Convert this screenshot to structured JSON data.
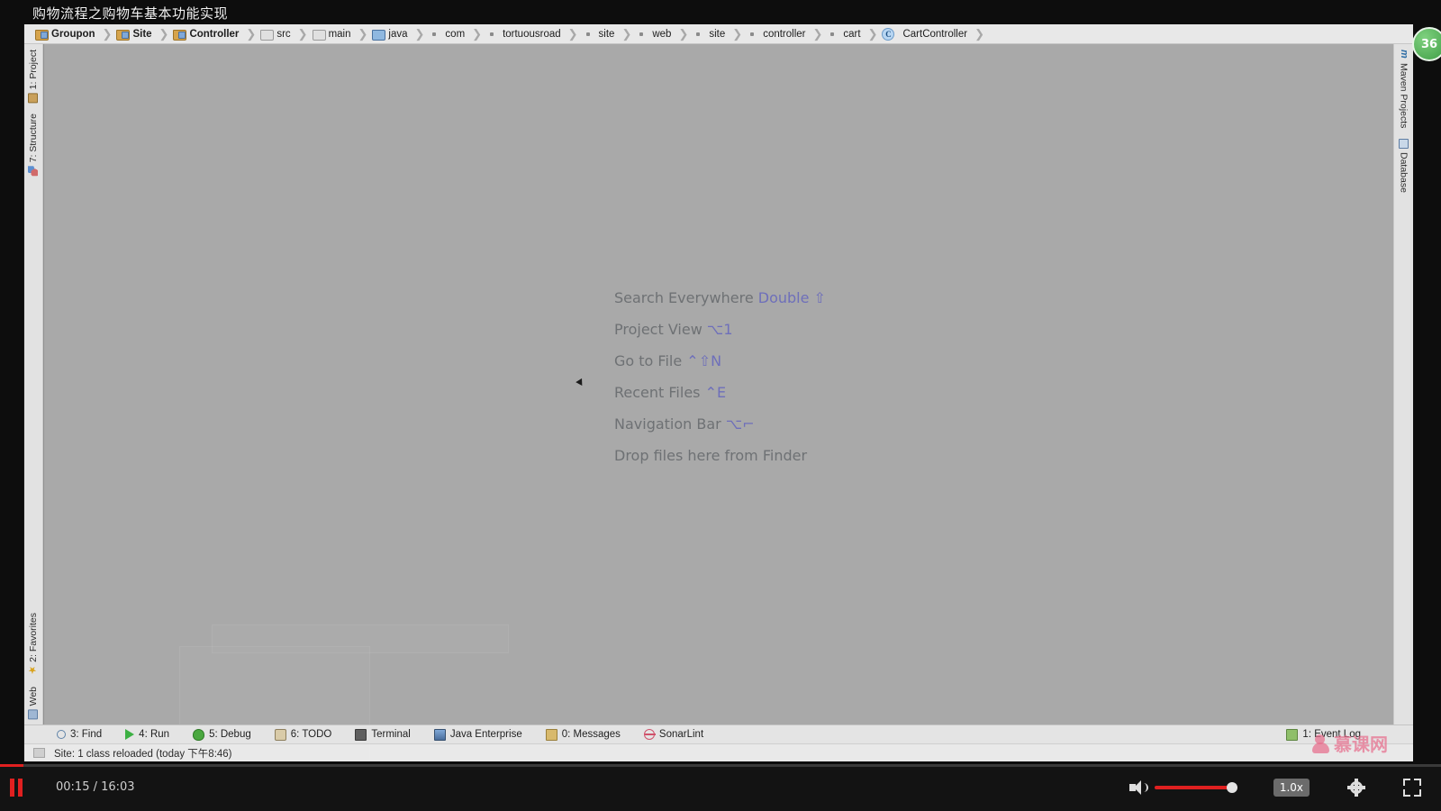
{
  "video": {
    "title": "购物流程之购物车基本功能实现",
    "current_time": "00:15",
    "duration": "16:03",
    "time_label": "00:15 / 16:03",
    "speed": "1.0x",
    "progress_percent": 1.6,
    "volume_percent": 87,
    "pause_icon": "pause-icon",
    "volume_icon": "volume-icon",
    "settings_icon": "gear-icon",
    "fullscreen_icon": "exit-fullscreen-icon",
    "accent_color": "#e02020"
  },
  "watermark": {
    "text": "慕课网",
    "color": "#e66e8c"
  },
  "notification_badge": {
    "count": "36",
    "color": "#3f9e46"
  },
  "breadcrumb": [
    {
      "label": "Groupon",
      "icon": "module-folder-icon",
      "bold": true,
      "type": "module"
    },
    {
      "label": "Site",
      "icon": "module-folder-icon",
      "bold": true,
      "type": "module"
    },
    {
      "label": "Controller",
      "icon": "module-folder-icon",
      "bold": true,
      "type": "module"
    },
    {
      "label": "src",
      "icon": "folder-icon",
      "bold": false,
      "type": "source"
    },
    {
      "label": "main",
      "icon": "folder-icon",
      "bold": false,
      "type": "source"
    },
    {
      "label": "java",
      "icon": "java-folder-icon",
      "bold": false,
      "type": "java"
    },
    {
      "label": "com",
      "icon": "package-icon",
      "bold": false,
      "type": "package"
    },
    {
      "label": "tortuousroad",
      "icon": "package-icon",
      "bold": false,
      "type": "package"
    },
    {
      "label": "site",
      "icon": "package-icon",
      "bold": false,
      "type": "package"
    },
    {
      "label": "web",
      "icon": "package-icon",
      "bold": false,
      "type": "package"
    },
    {
      "label": "site",
      "icon": "package-icon",
      "bold": false,
      "type": "package"
    },
    {
      "label": "controller",
      "icon": "package-icon",
      "bold": false,
      "type": "package"
    },
    {
      "label": "cart",
      "icon": "package-icon",
      "bold": false,
      "type": "package"
    },
    {
      "label": "CartController",
      "icon": "class-icon",
      "bold": false,
      "type": "class"
    }
  ],
  "left_strip_top": [
    {
      "label": "1: Project",
      "mnemonic": "1",
      "icon": "project-icon"
    },
    {
      "label": "7: Structure",
      "mnemonic": "7",
      "icon": "structure-icon"
    }
  ],
  "left_strip_bottom": [
    {
      "label": "2: Favorites",
      "mnemonic": "2",
      "icon": "star-icon"
    },
    {
      "label": "Web",
      "mnemonic": "",
      "icon": "web-icon"
    }
  ],
  "right_strip_top": [
    {
      "label": "Maven Projects",
      "icon": "maven-icon"
    },
    {
      "label": "Database",
      "icon": "database-icon"
    }
  ],
  "editor": {
    "hints": [
      {
        "action": "Search Everywhere",
        "shortcut": "Double ⇧"
      },
      {
        "action": "Project View",
        "shortcut": "⌥1"
      },
      {
        "action": "Go to File",
        "shortcut": "⌃⇧N"
      },
      {
        "action": "Recent Files",
        "shortcut": "⌃E"
      },
      {
        "action": "Navigation Bar",
        "shortcut": "⌥⌐"
      },
      {
        "action": "Drop files here from Finder",
        "shortcut": ""
      }
    ],
    "background_color": "#a9a9a9",
    "hint_color": "#6e7174",
    "shortcut_color": "#6e6fba"
  },
  "tool_windows": [
    {
      "label": "3: Find",
      "mnemonic": "3",
      "icon": "find-icon"
    },
    {
      "label": "4: Run",
      "mnemonic": "4",
      "icon": "run-icon"
    },
    {
      "label": "5: Debug",
      "mnemonic": "5",
      "icon": "debug-icon"
    },
    {
      "label": "6: TODO",
      "mnemonic": "6",
      "icon": "todo-icon"
    },
    {
      "label": "Terminal",
      "mnemonic": "",
      "icon": "terminal-icon"
    },
    {
      "label": "Java Enterprise",
      "mnemonic": "",
      "icon": "java-enterprise-icon"
    },
    {
      "label": "0: Messages",
      "mnemonic": "0",
      "icon": "messages-icon"
    },
    {
      "label": "SonarLint",
      "mnemonic": "",
      "icon": "sonarlint-icon"
    }
  ],
  "event_log": {
    "label": "1: Event Log",
    "mnemonic": "1",
    "icon": "event-log-icon"
  },
  "status_bar": {
    "message": "Site: 1 class reloaded (today 下午8:46)"
  }
}
